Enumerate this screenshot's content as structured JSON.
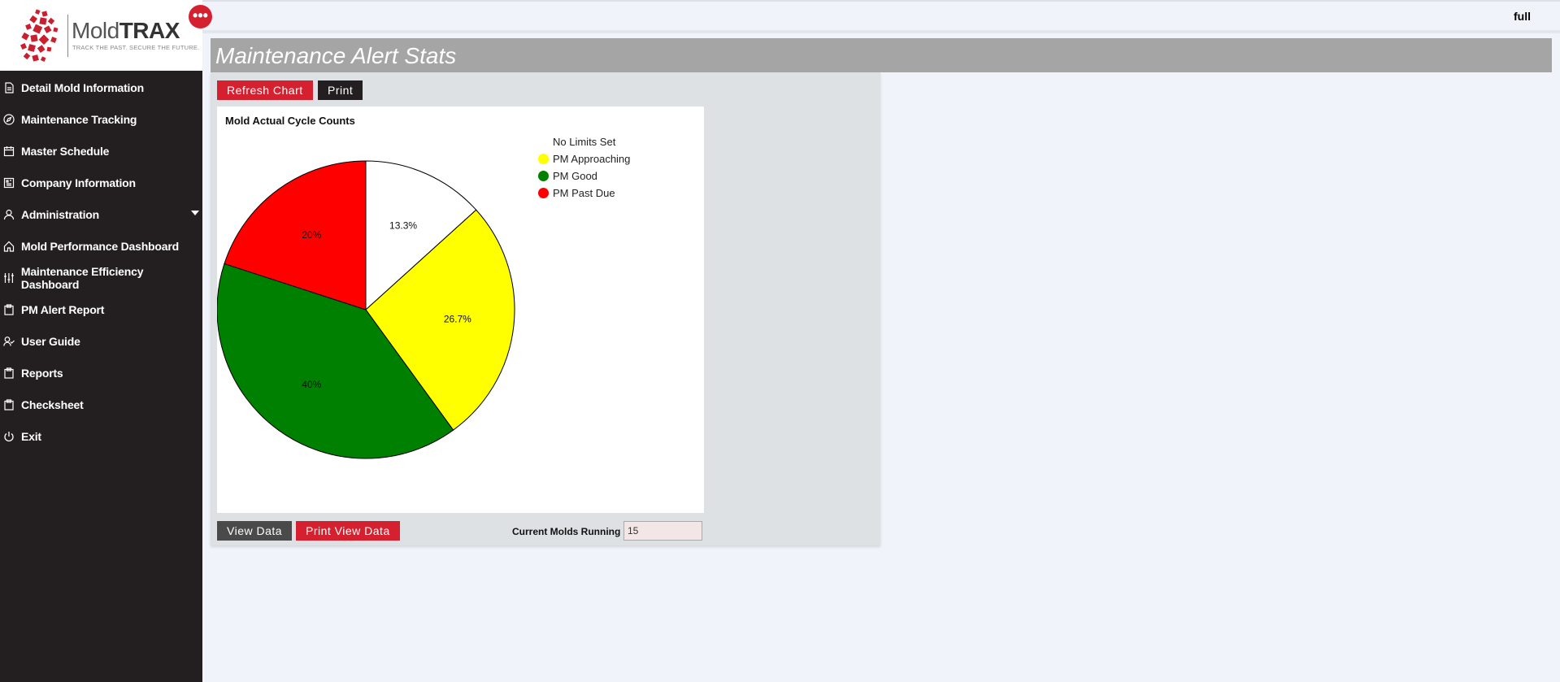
{
  "brand": {
    "name_regular": "Mold",
    "name_bold": "TRAX",
    "tagline": "TRACK THE PAST. SECURE THE FUTURE."
  },
  "sidebar": {
    "items": [
      {
        "label": "Detail Mold Information",
        "icon": "document-icon"
      },
      {
        "label": "Maintenance Tracking",
        "icon": "compass-icon"
      },
      {
        "label": "Master Schedule",
        "icon": "calendar-icon"
      },
      {
        "label": "Company Information",
        "icon": "building-icon"
      },
      {
        "label": "Administration",
        "icon": "user-icon",
        "has_submenu": true
      },
      {
        "label": "Mold Performance Dashboard",
        "icon": "home-icon"
      },
      {
        "label": "Maintenance Efficiency Dashboard",
        "icon": "sliders-icon"
      },
      {
        "label": "PM Alert Report",
        "icon": "clipboard-icon"
      },
      {
        "label": "User Guide",
        "icon": "user-check-icon"
      },
      {
        "label": "Reports",
        "icon": "clipboard-icon"
      },
      {
        "label": "Checksheet",
        "icon": "clipboard-icon"
      },
      {
        "label": "Exit",
        "icon": "power-icon"
      }
    ]
  },
  "header": {
    "mode": "full",
    "page_title": "Maintenance Alert Stats"
  },
  "toolbar": {
    "refresh_label": "Refresh Chart",
    "print_label": "Print"
  },
  "footer_actions": {
    "view_data_label": "View Data",
    "print_view_data_label": "Print View Data",
    "molds_running_label": "Current Molds Running",
    "molds_running_value": "15"
  },
  "colors": {
    "accent": "#d5202f",
    "sidebar": "#231f20",
    "title_bar": "#a5a5a5"
  },
  "chart_data": {
    "type": "pie",
    "title": "Mold Actual Cycle Counts",
    "slices": [
      {
        "label": "No Limits Set",
        "value": 13.3,
        "display": "13.3%",
        "color": "#ffffff"
      },
      {
        "label": "PM Approaching",
        "value": 26.7,
        "display": "26.7%",
        "color": "#ffff00"
      },
      {
        "label": "PM Good",
        "value": 40,
        "display": "40%",
        "color": "#008000"
      },
      {
        "label": "PM Past Due",
        "value": 20,
        "display": "20%",
        "color": "#ff0000"
      }
    ],
    "legend_position": "top-right"
  }
}
